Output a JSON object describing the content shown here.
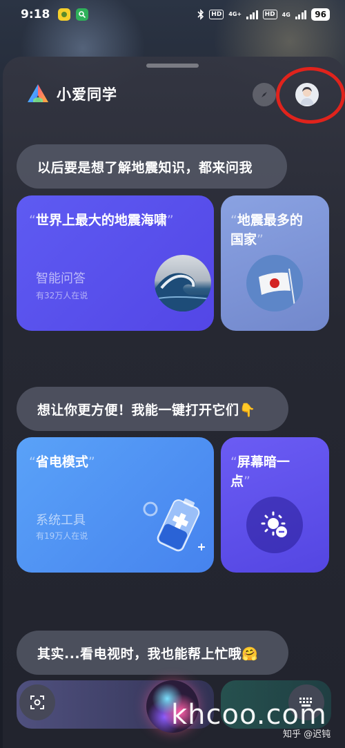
{
  "status_bar": {
    "time": "9:18",
    "signal_1_label": "4G+",
    "signal_2_label": "4G",
    "hd_label": "HD",
    "battery": "96"
  },
  "header": {
    "title": "小爱同学"
  },
  "sections": [
    {
      "prompt": "以后要是想了解地震知识，都来问我"
    },
    {
      "prompt": "想让你更方便！我能一键打开它们👇"
    },
    {
      "prompt": "其实...看电视时，我也能帮上忙哦🤗"
    }
  ],
  "cards": {
    "tsunami": {
      "open_quote": "“",
      "text": "世界上最大的地震海啸",
      "close_quote": "”",
      "category": "智能问答",
      "count": "有32万人在说"
    },
    "country": {
      "open_quote": "“",
      "text_line1": "地震最多的",
      "text_line2": "国家",
      "close_quote": "”"
    },
    "power_saving": {
      "open_quote": "“",
      "text": "省电模式",
      "close_quote": "”",
      "category": "系统工具",
      "count": "有19万人在说"
    },
    "screen_dim": {
      "open_quote": "“",
      "text_line1": "屏幕暗一",
      "text_line2": "点",
      "close_quote": "”"
    }
  },
  "watermark": {
    "site": "khcoo.com",
    "zhihu": "知乎 @迟钝"
  },
  "colors": {
    "tsunami_card": "#5b55f0",
    "country_card": "#7f97d8",
    "power_card": "#4d8df0",
    "screen_card": "#5a4fee",
    "annotation_red": "#e0231c"
  },
  "icons": [
    "scan-icon",
    "keyboard-icon",
    "compass-icon",
    "avatar-icon",
    "brightness-minus-icon",
    "battery-plus-icon",
    "app-logo-icon"
  ]
}
